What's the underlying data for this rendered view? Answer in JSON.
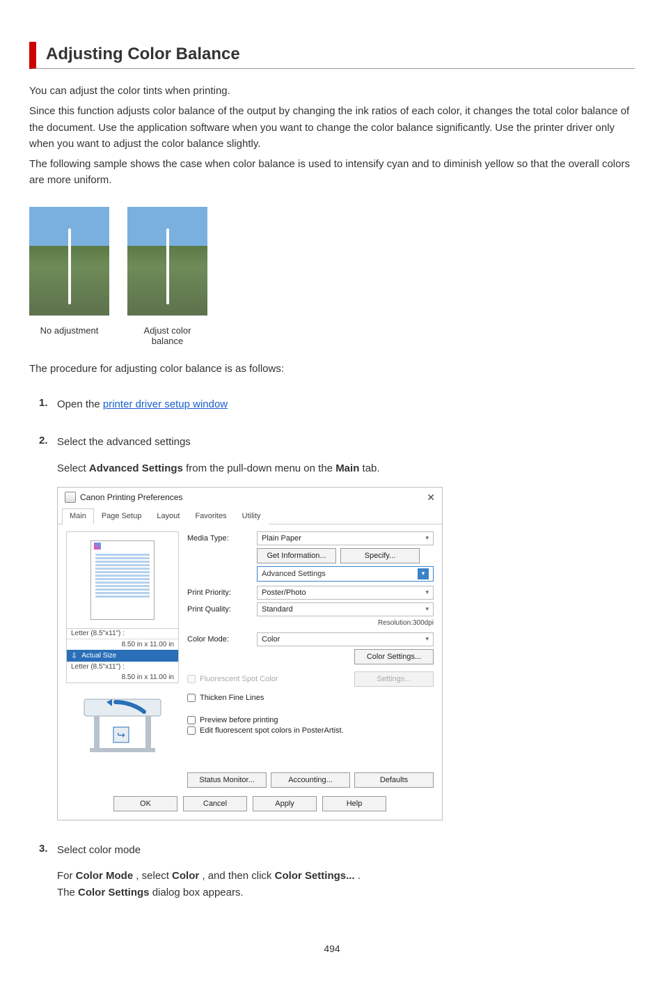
{
  "title": "Adjusting Color Balance",
  "intro": {
    "p1": "You can adjust the color tints when printing.",
    "p2": "Since this function adjusts color balance of the output by changing the ink ratios of each color, it changes the total color balance of the document. Use the application software when you want to change the color balance significantly. Use the printer driver only when you want to adjust the color balance slightly.",
    "p3": "The following sample shows the case when color balance is used to intensify cyan and to diminish yellow so that the overall colors are more uniform."
  },
  "captions": {
    "before": "No adjustment",
    "after": "Adjust color balance"
  },
  "procedure_intro": "The procedure for adjusting color balance is as follows:",
  "steps": [
    {
      "lead": "Open the ",
      "link": "printer driver setup window"
    },
    {
      "head": "Select the advanced settings",
      "body_pre": "Select ",
      "bold1": "Advanced Settings",
      "body_mid": " from the pull-down menu on the ",
      "bold2": "Main",
      "body_end": " tab."
    },
    {
      "head": "Select color mode",
      "t1": "For ",
      "b1": "Color Mode",
      "t2": ", select ",
      "b2": "Color",
      "t3": ", and then click ",
      "b3": "Color Settings...",
      "t4": ".",
      "t5": "The ",
      "b4": "Color Settings",
      "t6": " dialog box appears."
    }
  ],
  "dialog": {
    "title": "Canon           Printing Preferences",
    "tabs": [
      "Main",
      "Page Setup",
      "Layout",
      "Favorites",
      "Utility"
    ],
    "left": {
      "size1_label": "Letter (8.5\"x11\") :",
      "size1_dim": "8.50 in x 11.00 in",
      "actual": "Actual Size",
      "size2_label": "Letter (8.5\"x11\") :",
      "size2_dim": "8.50 in x 11.00 in"
    },
    "right": {
      "media_type_label": "Media Type:",
      "media_type_value": "Plain Paper",
      "get_info": "Get Information...",
      "specify": "Specify...",
      "adv_settings": "Advanced Settings",
      "priority_label": "Print Priority:",
      "priority_value": "Poster/Photo",
      "quality_label": "Print Quality:",
      "quality_value": "Standard",
      "resolution": "Resolution:300dpi",
      "color_mode_label": "Color Mode:",
      "color_mode_value": "Color",
      "color_settings_btn": "Color Settings...",
      "fluoro": "Fluorescent Spot Color",
      "settings_btn": "Settings...",
      "thicken": "Thicken Fine Lines",
      "preview_chk": "Preview before printing",
      "poster_chk": "Edit fluorescent spot colors in PosterArtist."
    },
    "footer": {
      "status": "Status Monitor...",
      "accounting": "Accounting...",
      "defaults": "Defaults",
      "ok": "OK",
      "cancel": "Cancel",
      "apply": "Apply",
      "help": "Help"
    }
  },
  "page_number": "494"
}
